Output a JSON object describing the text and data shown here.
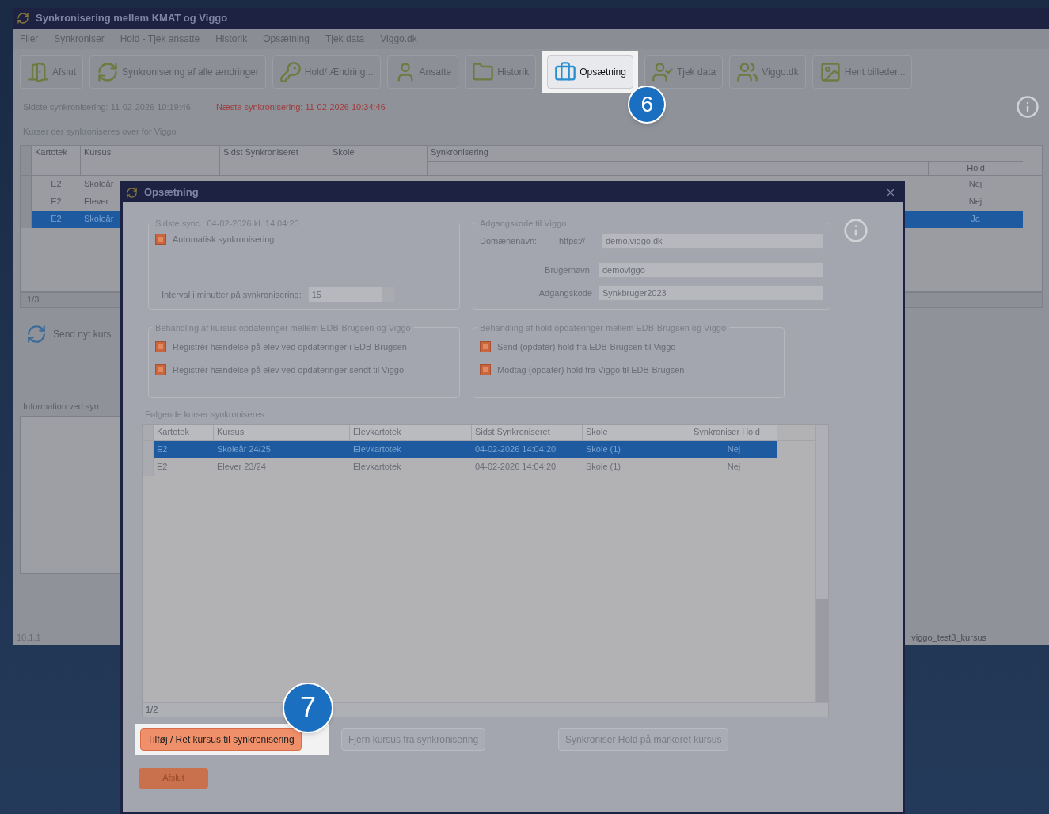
{
  "main_window": {
    "title": "Synkronisering mellem KMAT og Viggo",
    "menu": [
      "Filer",
      "Synkroniser",
      "Hold - Tjek ansatte",
      "Historik",
      "Opsætning",
      "Tjek data",
      "Viggo.dk"
    ],
    "toolbar": [
      {
        "label": "Afslut",
        "highlighted": false
      },
      {
        "label": "Synkronisering af alle ændringer",
        "highlighted": false
      },
      {
        "label": "Hold/ Ændring...",
        "highlighted": false
      },
      {
        "label": "Ansatte",
        "highlighted": false
      },
      {
        "label": "Historik",
        "highlighted": false
      },
      {
        "label": "Opsætning",
        "highlighted": true,
        "callout": "6"
      },
      {
        "label": "Tjek data",
        "highlighted": false
      },
      {
        "label": "Viggo.dk",
        "highlighted": false
      },
      {
        "label": "Hent billeder...",
        "highlighted": false
      }
    ],
    "last_sync": "Sidste synkronisering: 11-02-2026 10:19:46",
    "next_sync": "Næste synkronisering: 11-02-2026 10:34:46",
    "table_label": "Kurser der synkroniseres over for Viggo",
    "table": {
      "columns": [
        "Kartotek",
        "Kursus",
        "Sidst Synkroniseret",
        "Skole",
        "Synkronisering"
      ],
      "sub_column": "Hold",
      "rows": [
        {
          "kartotek": "E2",
          "kursus": "Skoleår",
          "hold": "Nej",
          "selected": false
        },
        {
          "kartotek": "E2",
          "kursus": "Elever",
          "hold": "Nej",
          "selected": false
        },
        {
          "kartotek": "E2",
          "kursus": "Skoleår",
          "hold": "Ja",
          "selected": true
        }
      ],
      "count": "1/3"
    },
    "send_button": "Send nyt kurs",
    "info_label": "Information ved syn",
    "version": "10.1.1",
    "status_right": "viggo_test3_kursus"
  },
  "dialog": {
    "title": "Opsætning",
    "sync_group": {
      "legend": "Sidste sync.: 04-02-2026 kl. 14:04:20",
      "auto_sync": {
        "label": "Automatisk synkronisering",
        "checked": true
      },
      "interval_label": "Interval i minutter på synkronisering:",
      "interval_value": "15"
    },
    "access_group": {
      "legend": "Adgangskode til Viggo",
      "domain_label": "Domænenavn:",
      "domain_prefix": "https://",
      "domain_value": "demo.viggo.dk",
      "user_label": "Brugernavn:",
      "user_value": "demoviggo",
      "password_label": "Adgangskode",
      "password_value": "Synkbruger2023"
    },
    "course_group": {
      "legend": "Behandling af kursus opdateringer mellem EDB-Brugsen og Viggo",
      "options": [
        {
          "label": "Registrér hændelse på elev ved opdateringer i EDB-Brugsen",
          "checked": true
        },
        {
          "label": "Registrér hændelse på elev ved opdateringer sendt til Viggo",
          "checked": true
        }
      ]
    },
    "team_group": {
      "legend": "Behandling af hold opdateringer mellem EDB-Brugsen og Viggo",
      "options": [
        {
          "label": "Send (opdatér) hold fra EDB-Brugsen til Viggo",
          "checked": true
        },
        {
          "label": "Modtag (opdatér) hold fra Viggo til EDB-Brugsen",
          "checked": true
        }
      ]
    },
    "table_label": "Følgende kurser synkroniseres",
    "table": {
      "columns": [
        "Kartotek",
        "Kursus",
        "Elevkartotek",
        "Sidst Synkroniseret",
        "Skole",
        "Synkroniser Hold"
      ],
      "rows": [
        {
          "cells": [
            "E2",
            "Skoleår 24/25",
            "Elevkartotek",
            "04-02-2026 14:04:20",
            "Skole (1)",
            "Nej"
          ],
          "selected": true
        },
        {
          "cells": [
            "E2",
            "Elever 23/24",
            "Elevkartotek",
            "04-02-2026 14:04:20",
            "Skole (1)",
            "Nej"
          ],
          "selected": false
        }
      ],
      "count": "1/2"
    },
    "buttons": [
      {
        "label": "Tilføj / Ret kursus til synkronisering",
        "highlighted": true,
        "callout": "7"
      },
      {
        "label": "Fjern kursus fra synkronisering",
        "highlighted": false
      },
      {
        "label": "Synkroniser Hold på markeret kursus",
        "highlighted": false
      }
    ],
    "close_button": "Afslut"
  }
}
